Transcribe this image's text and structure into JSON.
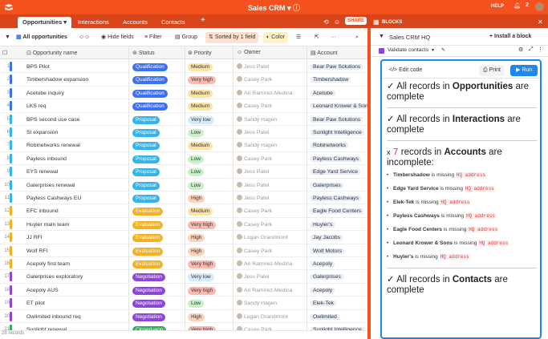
{
  "app": {
    "title": "Sales CRM",
    "help": "HELP"
  },
  "tabs": [
    "Opportunities",
    "Interactions",
    "Accounts",
    "Contacts"
  ],
  "share_label": "SHARE",
  "blocks_label": "BLOCKS",
  "toolbar": {
    "view": "All opportunities",
    "hide": "Hide fields",
    "filter": "Filter",
    "group": "Group",
    "sorted": "Sorted by 1 field",
    "color": "Color"
  },
  "columns": [
    "Opportunity name",
    "Status",
    "Priority",
    "Owner",
    "Account"
  ],
  "rows": [
    {
      "n": "1",
      "name": "BPS Pilot",
      "bar": "#3b6ff5",
      "status": "Qualification",
      "sc": "#3b6ff5",
      "prio": "Medium",
      "pc": "#fde4a6",
      "owner": "Jess Patel",
      "acct": "Bear Paw Solutions"
    },
    {
      "n": "2",
      "name": "Timbershadow expansion",
      "bar": "#3b6ff5",
      "status": "Qualification",
      "sc": "#3b6ff5",
      "prio": "Very high",
      "pc": "#fbb9b2",
      "owner": "Casey Park",
      "acct": "Timbershadow"
    },
    {
      "n": "3",
      "name": "Acetube inquiry",
      "bar": "#3b6ff5",
      "status": "Qualification",
      "sc": "#3b6ff5",
      "prio": "Medium",
      "pc": "#fde4a6",
      "owner": "Ari Ramírez-Medina",
      "acct": "Acetube"
    },
    {
      "n": "4",
      "name": "LKS req",
      "bar": "#3b6ff5",
      "status": "Qualification",
      "sc": "#3b6ff5",
      "prio": "Medium",
      "pc": "#fde4a6",
      "owner": "Casey Park",
      "acct": "Leonard Krower & Sons"
    },
    {
      "n": "5",
      "name": "BPS second use case",
      "bar": "#36b3ec",
      "status": "Proposal",
      "sc": "#36b3ec",
      "prio": "Very low",
      "pc": "#d2ecfa",
      "owner": "Sandy Hagen",
      "acct": "Bear Paw Solutions"
    },
    {
      "n": "6",
      "name": "SI expansion",
      "bar": "#36b3ec",
      "status": "Proposal",
      "sc": "#36b3ec",
      "prio": "Low",
      "pc": "#c8f0c9",
      "owner": "Jess Patel",
      "acct": "Sunlight Intelligence"
    },
    {
      "n": "7",
      "name": "Robinetworks renewal",
      "bar": "#36b3ec",
      "status": "Proposal",
      "sc": "#36b3ec",
      "prio": "Medium",
      "pc": "#fde4a6",
      "owner": "Sandy Hagen",
      "acct": "Robinetworks"
    },
    {
      "n": "8",
      "name": "Payless inbound",
      "bar": "#36b3ec",
      "status": "Proposal",
      "sc": "#36b3ec",
      "prio": "Low",
      "pc": "#c8f0c9",
      "owner": "Casey Park",
      "acct": "Payless Cashways"
    },
    {
      "n": "9",
      "name": "EYS renewal",
      "bar": "#36b3ec",
      "status": "Proposal",
      "sc": "#36b3ec",
      "prio": "Low",
      "pc": "#c8f0c9",
      "owner": "Jess Patel",
      "acct": "Edge Yard Service"
    },
    {
      "n": "10",
      "name": "Galerprises renewal",
      "bar": "#36b3ec",
      "status": "Proposal",
      "sc": "#36b3ec",
      "prio": "Low",
      "pc": "#c8f0c9",
      "owner": "Jess Patel",
      "acct": "Galerprises"
    },
    {
      "n": "11",
      "name": "Payless Cashways EU",
      "bar": "#36b3ec",
      "status": "Proposal",
      "sc": "#36b3ec",
      "prio": "High",
      "pc": "#fdd2b8",
      "owner": "Jess Patel",
      "acct": "Payless Cashways"
    },
    {
      "n": "12",
      "name": "EFC inbound",
      "bar": "#f5b021",
      "status": "Evaluation",
      "sc": "#f5b021",
      "prio": "Medium",
      "pc": "#fde4a6",
      "owner": "Casey Park",
      "acct": "Eagle Food Centers"
    },
    {
      "n": "13",
      "name": "Huyler main team",
      "bar": "#f5b021",
      "status": "Evaluation",
      "sc": "#f5b021",
      "prio": "Very high",
      "pc": "#fbb9b2",
      "owner": "Casey Park",
      "acct": "Huyler's"
    },
    {
      "n": "14",
      "name": "JJ RFI",
      "bar": "#f5b021",
      "status": "Evaluation",
      "sc": "#f5b021",
      "prio": "High",
      "pc": "#fdd2b8",
      "owner": "Logan Grandmont",
      "acct": "Jay Jacobs"
    },
    {
      "n": "15",
      "name": "Wolf RFI",
      "bar": "#f5b021",
      "status": "Evaluation",
      "sc": "#f5b021",
      "prio": "High",
      "pc": "#fdd2b8",
      "owner": "Casey Park",
      "acct": "Wolf Motors"
    },
    {
      "n": "16",
      "name": "Acepoly first team",
      "bar": "#f5b021",
      "status": "Evaluation",
      "sc": "#f5b021",
      "prio": "Very high",
      "pc": "#fbb9b2",
      "owner": "Ari Ramírez-Medina",
      "acct": "Acepoly"
    },
    {
      "n": "17",
      "name": "Galerprises exploratory",
      "bar": "#8b47d6",
      "status": "Negotiation",
      "sc": "#8b47d6",
      "prio": "Very low",
      "pc": "#d2ecfa",
      "owner": "Jess Patel",
      "acct": "Galerprises"
    },
    {
      "n": "18",
      "name": "Acepoly AUS",
      "bar": "#8b47d6",
      "status": "Negotiation",
      "sc": "#8b47d6",
      "prio": "Very high",
      "pc": "#fbb9b2",
      "owner": "Ari Ramírez-Medina",
      "acct": "Acepoly"
    },
    {
      "n": "19",
      "name": "ET pilot",
      "bar": "#8b47d6",
      "status": "Negotiation",
      "sc": "#8b47d6",
      "prio": "Low",
      "pc": "#c8f0c9",
      "owner": "Sandy Hagen",
      "acct": "Elek-Tek"
    },
    {
      "n": "20",
      "name": "Owlimited inbound req",
      "bar": "#8b47d6",
      "status": "Negotiation",
      "sc": "#8b47d6",
      "prio": "High",
      "pc": "#fdd2b8",
      "owner": "Logan Grandmont",
      "acct": "Owlimited"
    },
    {
      "n": "21",
      "name": "Sunlight renewal",
      "bar": "#2fae5f",
      "status": "Closed-won",
      "sc": "#2fae5f",
      "prio": "Very high",
      "pc": "#fbb9b2",
      "owner": "Casey Park",
      "acct": "Sunlight Intelligence"
    }
  ],
  "records": "28 records",
  "panel": {
    "title": "Sales CRM HQ",
    "install": "Install a block",
    "block": "Validate contacts",
    "edit": "Edit code",
    "print": "Print",
    "run": "Run"
  },
  "report": {
    "opp_pre": "All records in ",
    "opp_b": "Opportunities",
    "opp_post": " are complete",
    "int_pre": "All records in ",
    "int_b": "Interactions",
    "int_post": " are complete",
    "acc_count": "7",
    "acc_mid": " records in ",
    "acc_b": "Accounts",
    "acc_post": " are incomplete:",
    "missing": " is missing ",
    "field": "HQ address",
    "items": [
      "Timbershadow",
      "Edge Yard Service",
      "Elek-Tek",
      "Payless Cashways",
      "Eagle Food Centers",
      "Leonard Krower & Sons",
      "Huyler's"
    ],
    "con_pre": "All records in ",
    "con_b": "Contacts",
    "con_post": " are complete"
  }
}
